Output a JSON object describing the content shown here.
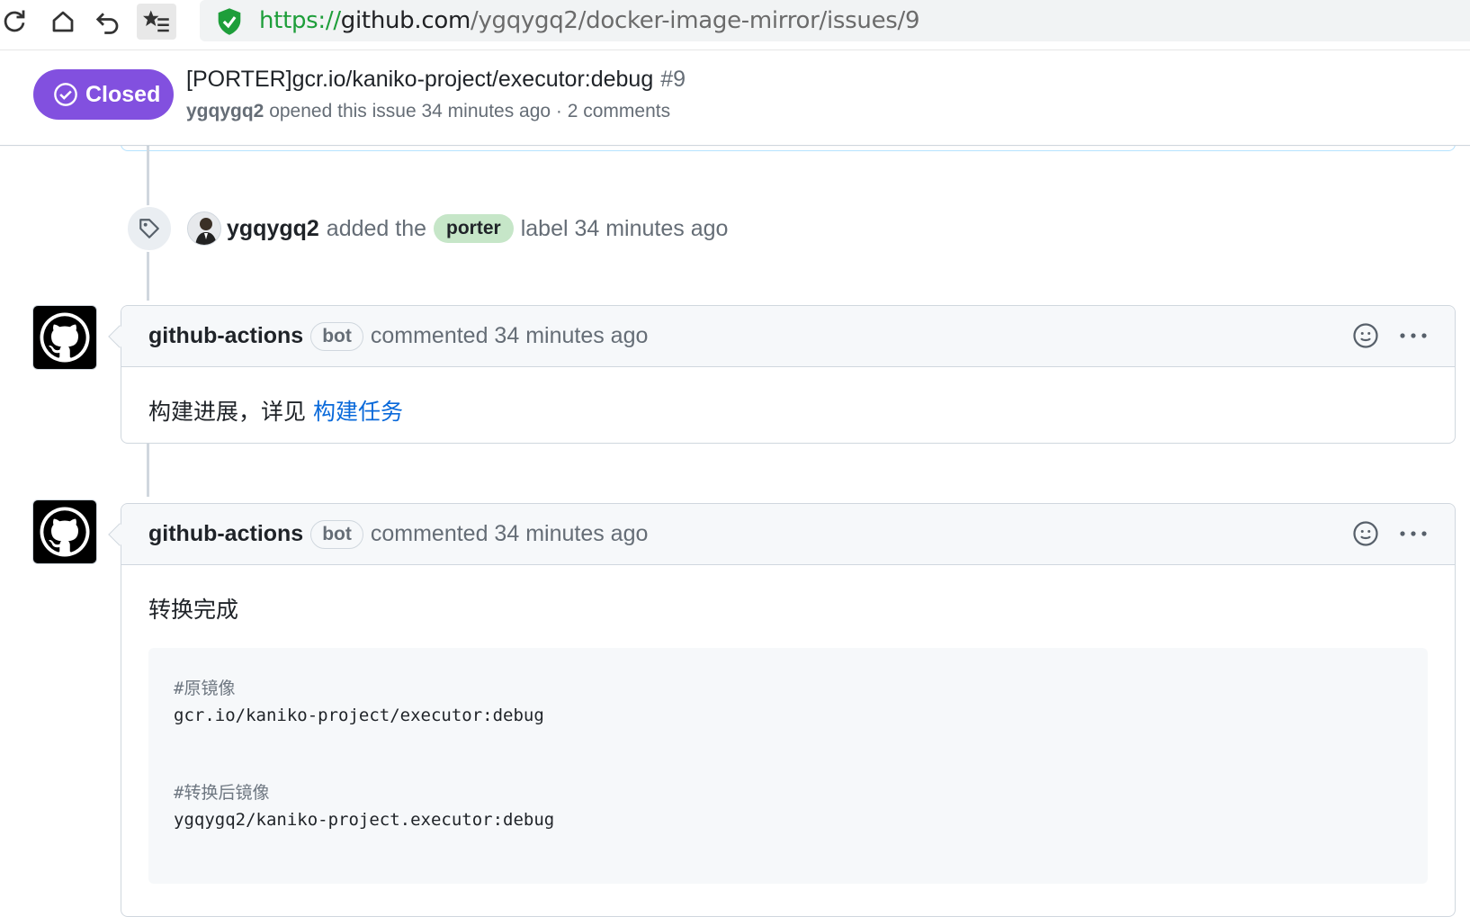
{
  "browser": {
    "url_scheme": "https://",
    "url_host": "github.com",
    "url_path": "/ygqygq2/docker-image-mirror/issues/9"
  },
  "issue": {
    "state": "Closed",
    "title": "[PORTER]gcr.io/kaniko-project/executor:debug",
    "number": "#9",
    "author": "ygqygq2",
    "meta": "opened this issue 34 minutes ago · 2 comments"
  },
  "event": {
    "user": "ygqygq2",
    "action": "added the",
    "label": "porter",
    "tail": "label 34 minutes ago"
  },
  "comments": [
    {
      "author": "github-actions",
      "badge": "bot",
      "action": "commented 34 minutes ago",
      "body_text": "构建进展，详见 ",
      "body_link": "构建任务"
    },
    {
      "author": "github-actions",
      "badge": "bot",
      "action": "commented 34 minutes ago",
      "body_text": "转换完成",
      "code": {
        "comment1": "#原镜像",
        "line1": "gcr.io/kaniko-project/executor:debug",
        "comment2": "#转换后镜像",
        "line2": "ygqygq2/kaniko-project.executor:debug"
      }
    }
  ],
  "colors": {
    "closed": "#8250df",
    "label": "#c6e6c8",
    "link": "#0969da",
    "secure": "#1e9e3a"
  }
}
